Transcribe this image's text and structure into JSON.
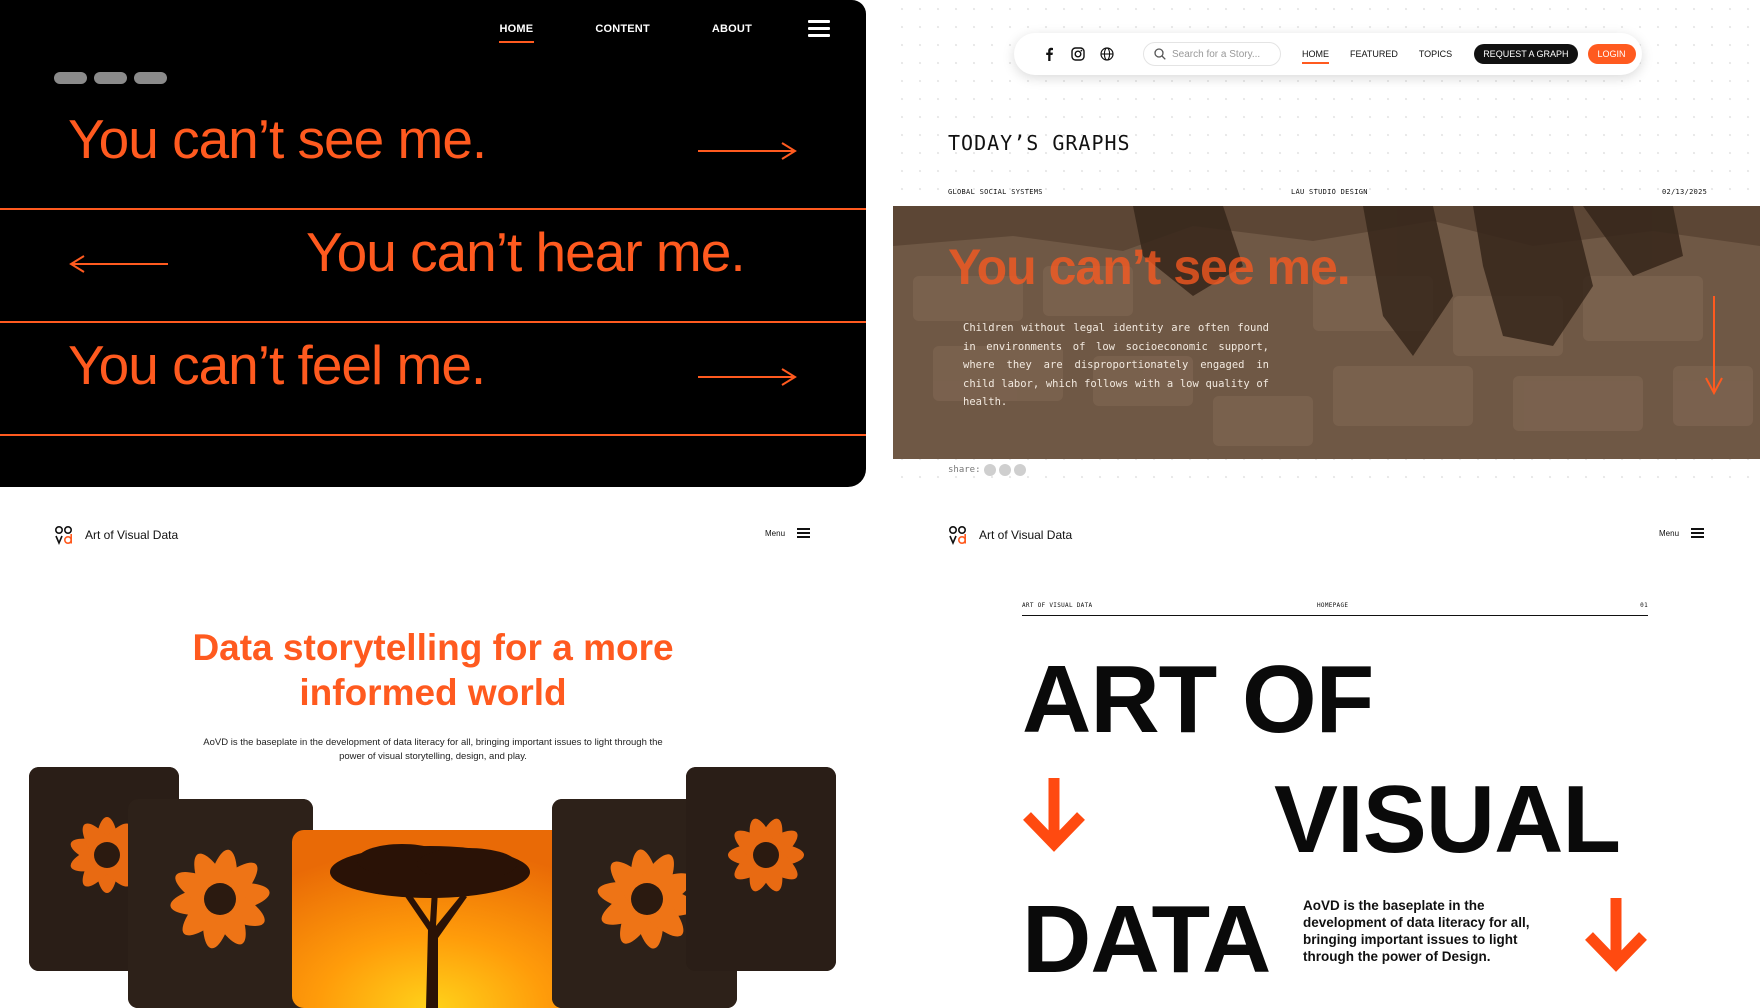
{
  "accent_color": "#ff5a1f",
  "panel_hero": {
    "nav": [
      "HOME",
      "CONTENT",
      "ABOUT"
    ],
    "active_nav": "HOME",
    "menu_icon": "hamburger-menu-icon",
    "rows": [
      {
        "text": "You can’t see me.",
        "arrow": "arrow-right-icon"
      },
      {
        "text": "You can’t hear me.",
        "arrow": "arrow-left-icon"
      },
      {
        "text": "You can’t feel me.",
        "arrow": "arrow-right-icon"
      }
    ]
  },
  "panel_graphs": {
    "social_icons": [
      "facebook-icon",
      "instagram-icon",
      "globe-icon"
    ],
    "search_placeholder": "Search for a Story...",
    "nav": [
      "HOME",
      "FEATURED",
      "TOPICS"
    ],
    "request_label": "REQUEST A GRAPH",
    "login_label": "LOGIN",
    "title": "TODAY’S GRAPHS",
    "meta_left": "GLOBAL SOCIAL SYSTEMS",
    "meta_center": "LAU STUDIO DESIGN",
    "meta_right": "02/13/2025",
    "overlay_title": "You can’t see me.",
    "body": "Children without legal identity are often found in environments of low socioeconomic support, where they are disproportionately engaged in child labor, which follows with a low quality of health.",
    "share_label": "share:"
  },
  "panel_story": {
    "brand": "Art of Visual Data",
    "menu_label": "Menu",
    "headline_line1": "Data storytelling for a more",
    "headline_line2": "informed world",
    "lead": "AoVD is the baseplate in the development of data literacy for all, bringing important issues to light through the power of visual storytelling, design, and play."
  },
  "panel_home": {
    "brand": "Art of Visual Data",
    "menu_label": "Menu",
    "meta_left": "ART OF VISUAL DATA",
    "meta_center": "HOMEPAGE",
    "meta_right": "01",
    "word1": "ART OF",
    "word2": "VISUAL",
    "word3": "DATA",
    "description": "AoVD is the baseplate in the development of data literacy for all, bringing important issues to light through the power of Design."
  }
}
